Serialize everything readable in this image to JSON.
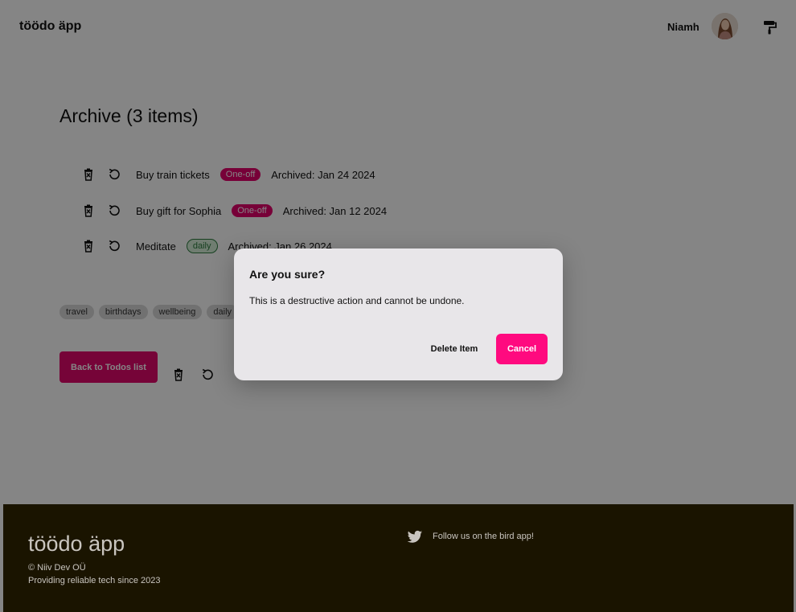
{
  "header": {
    "logo": "töödo äpp",
    "user_name": "Niamh"
  },
  "archive": {
    "title": "Archive (3 items)",
    "items": [
      {
        "title": "Buy train tickets",
        "badge": "One-off",
        "archived": "Archived: Jan 24 2024"
      },
      {
        "title": "Buy gift for Sophia",
        "badge": "One-off",
        "archived": "Archived: Jan 12 2024"
      },
      {
        "title": "Meditate",
        "badge": "daily",
        "archived": "Archived: Jan 26 2024"
      }
    ],
    "tags": [
      "travel",
      "birthdays",
      "wellbeing",
      "daily"
    ],
    "back_button": "Back to Todos list"
  },
  "dialog": {
    "title": "Are you sure?",
    "body": "This is a destructive action and cannot be undone.",
    "delete_label": "Delete Item",
    "cancel_label": "Cancel"
  },
  "footer": {
    "logo": "töödo äpp",
    "copyright": "© Niiv Dev OÜ",
    "tagline": "Providing reliable tech since 2023",
    "follow": "Follow us on the bird app!"
  },
  "colors": {
    "accent": "#e3096b",
    "footer_bg": "#1a1400",
    "overlay": "rgba(0,0,0,0.48)"
  }
}
